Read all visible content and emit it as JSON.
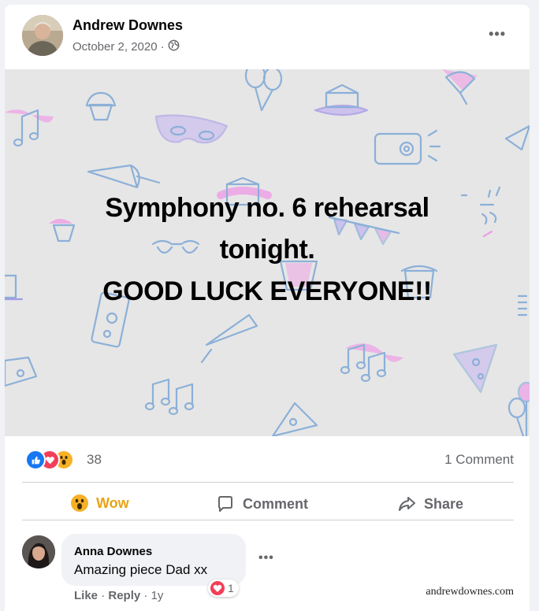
{
  "post": {
    "author": "Andrew Downes",
    "date": "October 2, 2020",
    "date_separator": "·",
    "privacy_icon": "globe-icon",
    "more_label": "•••"
  },
  "banner": {
    "background": "#e6e6e6",
    "line1": "Symphony no. 6 rehearsal",
    "line2": "tonight.",
    "line3": "GOOD LUCK EVERYONE!!"
  },
  "stats": {
    "reactions": [
      "like",
      "love",
      "wow"
    ],
    "reaction_count": "38",
    "comments_label": "1 Comment"
  },
  "actions": {
    "wow_label": "Wow",
    "comment_label": "Comment",
    "share_label": "Share"
  },
  "comment": {
    "author": "Anna Downes",
    "text": "Amazing piece Dad xx",
    "more_label": "•••",
    "reaction_count": "1",
    "like_label": "Like",
    "sep": "·",
    "reply_label": "Reply",
    "age": "1y"
  },
  "watermark": "andrewdownes.com",
  "colors": {
    "like_blue": "#1877f2",
    "love_red": "#f33e58",
    "wow_yellow": "#f7b125",
    "wow_text": "#e9a313",
    "secondary_text": "#65676b"
  }
}
